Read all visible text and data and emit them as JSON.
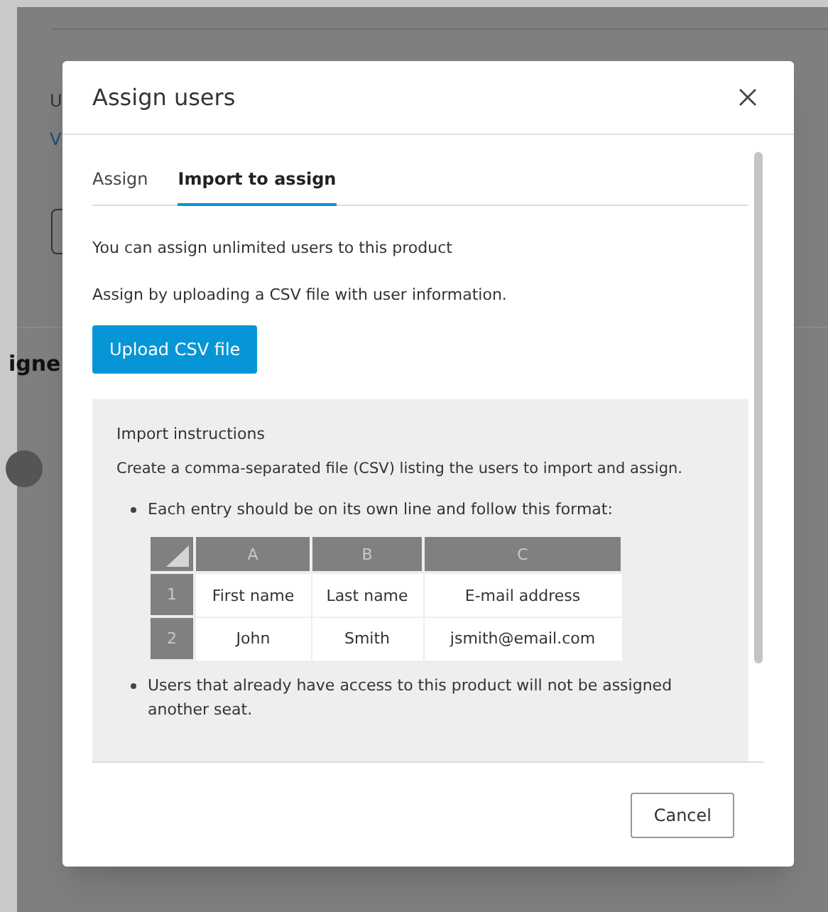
{
  "background": {
    "texts": [
      "U",
      "V",
      "igne"
    ]
  },
  "dialog": {
    "title": "Assign users",
    "tabs": [
      {
        "label": "Assign",
        "selected": false
      },
      {
        "label": "Import to assign",
        "selected": true
      }
    ],
    "intro": "You can assign unlimited users to this product",
    "upload_hint": "Assign by uploading a CSV file with user information.",
    "upload_button": "Upload CSV file",
    "instructions": {
      "title": "Import instructions",
      "text": "Create a comma-separated file (CSV) listing the users to import and assign.",
      "bullets": [
        "Each entry should be on its own line and follow this format:",
        "Users that already have access to this product will not be assigned another seat."
      ],
      "table": {
        "columns": [
          "A",
          "B",
          "C"
        ],
        "rows": [
          {
            "number": "1",
            "cells": [
              "First name",
              "Last name",
              "E-mail address"
            ]
          },
          {
            "number": "2",
            "cells": [
              "John",
              "Smith",
              "jsmith@email.com"
            ]
          }
        ]
      }
    },
    "buttons": [
      "Cancel"
    ]
  }
}
